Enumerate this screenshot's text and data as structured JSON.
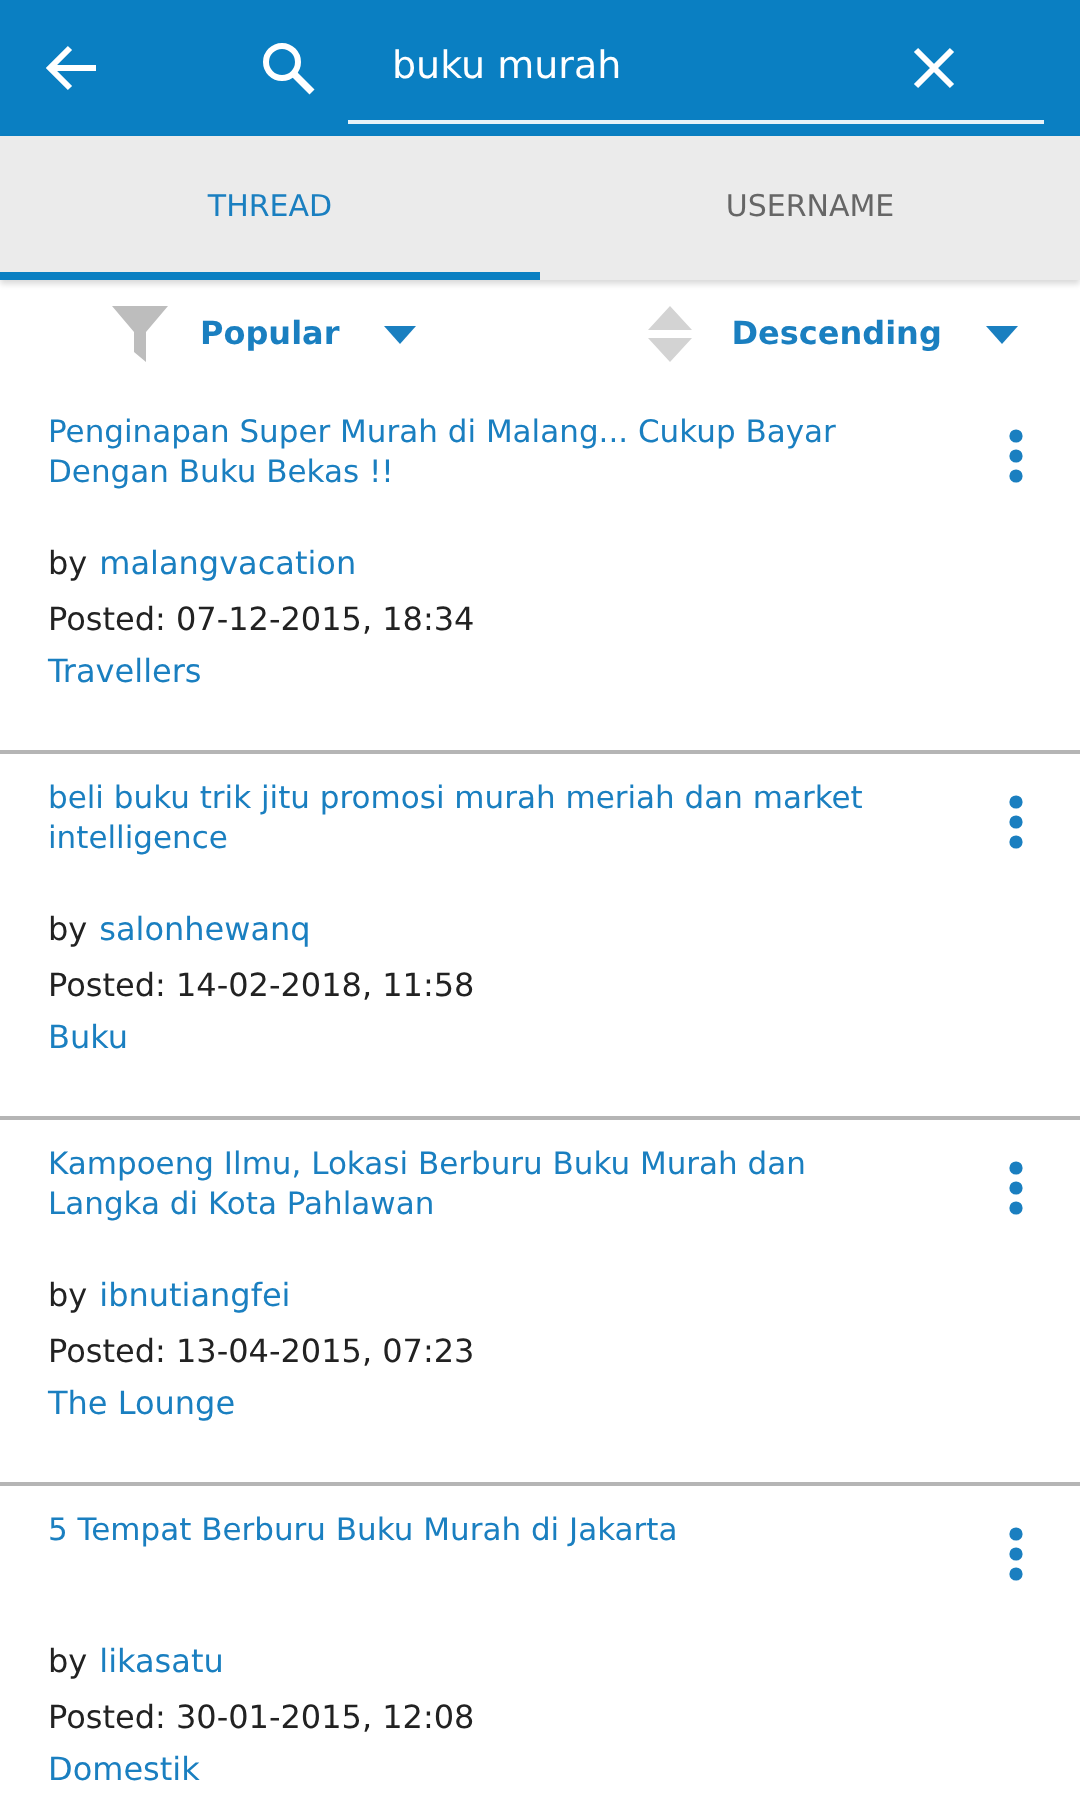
{
  "search": {
    "value": "buku murah"
  },
  "tabs": [
    {
      "label": "THREAD",
      "selected": true
    },
    {
      "label": "USERNAME",
      "selected": false
    }
  ],
  "sort": {
    "filter": "Popular",
    "order": "Descending"
  },
  "threads": [
    {
      "title": "Penginapan Super Murah di Malang... Cukup Bayar Dengan Buku Bekas !!",
      "by": "by",
      "author": "malangvacation",
      "posted": "Posted: 07-12-2015, 18:34",
      "category": "Travellers"
    },
    {
      "title": "beli buku trik jitu promosi murah meriah dan market intelligence",
      "by": "by",
      "author": "salonhewanq",
      "posted": "Posted: 14-02-2018, 11:58",
      "category": "Buku"
    },
    {
      "title": "Kampoeng Ilmu, Lokasi Berburu Buku Murah dan Langka di Kota Pahlawan",
      "by": "by",
      "author": "ibnutiangfei",
      "posted": "Posted: 13-04-2015, 07:23",
      "category": "The Lounge"
    },
    {
      "title": "5 Tempat Berburu Buku Murah di Jakarta",
      "by": "by",
      "author": "likasatu",
      "posted": "Posted: 30-01-2015, 12:08",
      "category": "Domestik"
    }
  ]
}
